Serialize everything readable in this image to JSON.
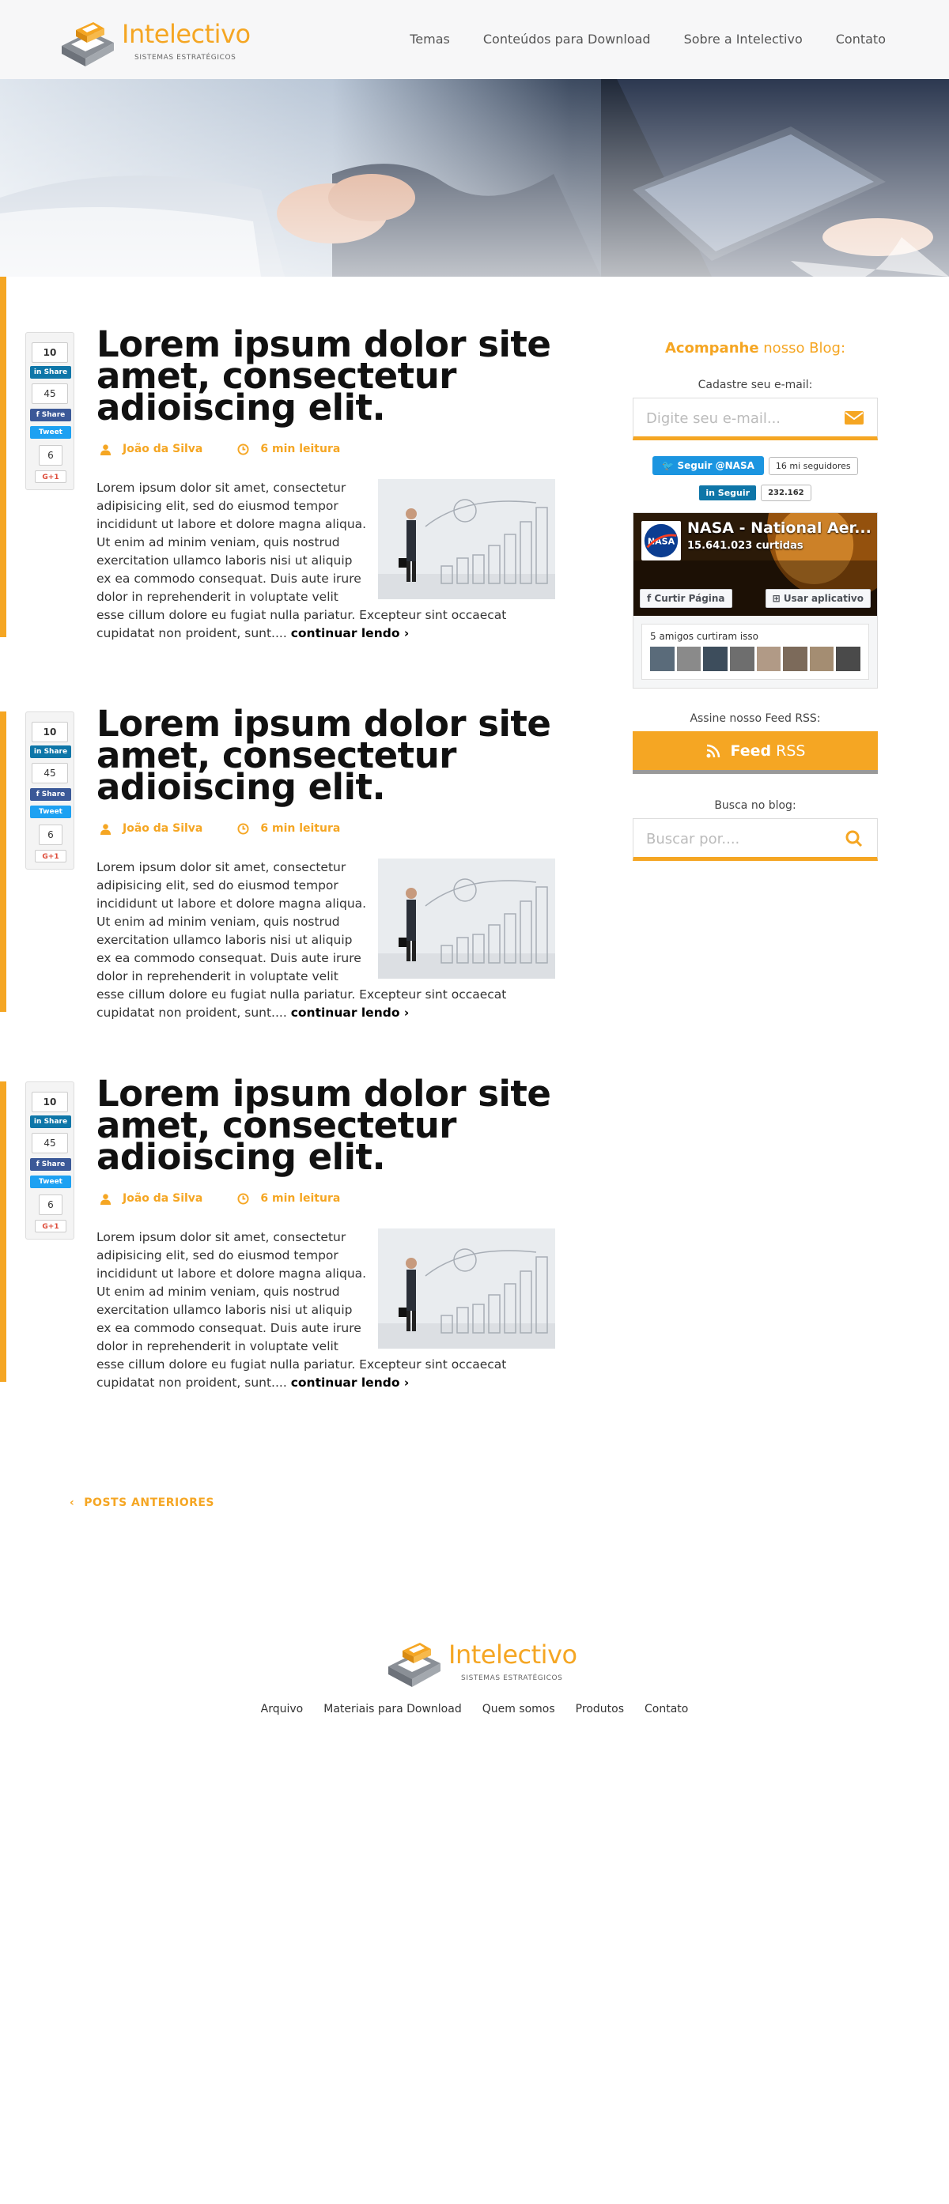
{
  "brand": {
    "name": "Intelectivo",
    "tagline": "SISTEMAS ESTRATÉGICOS",
    "accent_color": "#f5a623"
  },
  "nav": {
    "items": [
      "Temas",
      "Conteúdos para Download",
      "Sobre a Intelectivo",
      "Contato"
    ]
  },
  "posts": [
    {
      "title_bold": "Lorem ipsum",
      "title_rest": " dolor site amet, consectetur adioiscing elit.",
      "author": "João da Silva",
      "read_time": "6 min leitura",
      "body": "Lorem ipsum dolor sit amet, consectetur adipisicing elit, sed do eiusmod tempor incididunt ut labore et dolore magna aliqua. Ut enim ad minim veniam, quis nostrud exercitation ullamco laboris nisi ut aliquip ex ea commodo consequat. Duis aute irure dolor in reprehenderit in voluptate velit esse cillum dolore eu fugiat nulla pariatur. Excepteur sint occaecat cupidatat non proident, sunt....",
      "more": "continuar lendo ›",
      "share": {
        "total": "10",
        "linkedin_label": "Share",
        "linkedin_count": "45",
        "facebook_label": "Share",
        "twitter_label": "Tweet",
        "gplus_count": "6",
        "gplus_label": "G+1"
      }
    },
    {
      "title_bold": "Lorem ipsum",
      "title_rest": " dolor site amet, consectetur adioiscing elit.",
      "author": "João da Silva",
      "read_time": "6 min leitura",
      "body": "Lorem ipsum dolor sit amet, consectetur adipisicing elit, sed do eiusmod tempor incididunt ut labore et dolore magna aliqua. Ut enim ad minim veniam, quis nostrud exercitation ullamco laboris nisi ut aliquip ex ea commodo consequat. Duis aute irure dolor in reprehenderit in voluptate velit esse cillum dolore eu fugiat nulla pariatur. Excepteur sint occaecat cupidatat non proident, sunt....",
      "more": "continuar lendo ›",
      "share": {
        "total": "10",
        "linkedin_label": "Share",
        "linkedin_count": "45",
        "facebook_label": "Share",
        "twitter_label": "Tweet",
        "gplus_count": "6",
        "gplus_label": "G+1"
      }
    },
    {
      "title_bold": "Lorem ipsum",
      "title_rest": " dolor site amet, consectetur adioiscing elit.",
      "author": "João da Silva",
      "read_time": "6 min leitura",
      "body": "Lorem ipsum dolor sit amet, consectetur adipisicing elit, sed do eiusmod tempor incididunt ut labore et dolore magna aliqua. Ut enim ad minim veniam, quis nostrud exercitation ullamco laboris nisi ut aliquip ex ea commodo consequat. Duis aute irure dolor in reprehenderit in voluptate velit esse cillum dolore eu fugiat nulla pariatur. Excepteur sint occaecat cupidatat non proident, sunt....",
      "more": "continuar lendo ›",
      "share": {
        "total": "10",
        "linkedin_label": "Share",
        "linkedin_count": "45",
        "facebook_label": "Share",
        "twitter_label": "Tweet",
        "gplus_count": "6",
        "gplus_label": "G+1"
      }
    }
  ],
  "sidebar": {
    "title_bold": "Acompanhe",
    "title_rest": " nosso Blog:",
    "email_label": "Cadastre seu e-mail:",
    "email_placeholder": "Digite seu e-mail...",
    "twitter_follow": "Seguir @NASA",
    "twitter_followers": "16 mi seguidores",
    "linkedin_follow": "Seguir",
    "linkedin_count": "232.162",
    "fb_page_name": "NASA - National Aer...",
    "fb_likes": "15.641.023 curtidas",
    "fb_like_button": "Curtir Página",
    "fb_app_button": "Usar aplicativo",
    "fb_friends": "5 amigos curtiram isso",
    "rss_label": "Assine nosso Feed RSS:",
    "rss_bold": "Feed",
    "rss_rest": "RSS",
    "search_label": "Busca no blog:",
    "search_placeholder": "Buscar por...."
  },
  "pager": {
    "previous": "POSTS ANTERIORES"
  },
  "footer": {
    "links": [
      "Arquivo",
      "Materiais para Download",
      "Quem somos",
      "Produtos",
      "Contato"
    ]
  }
}
